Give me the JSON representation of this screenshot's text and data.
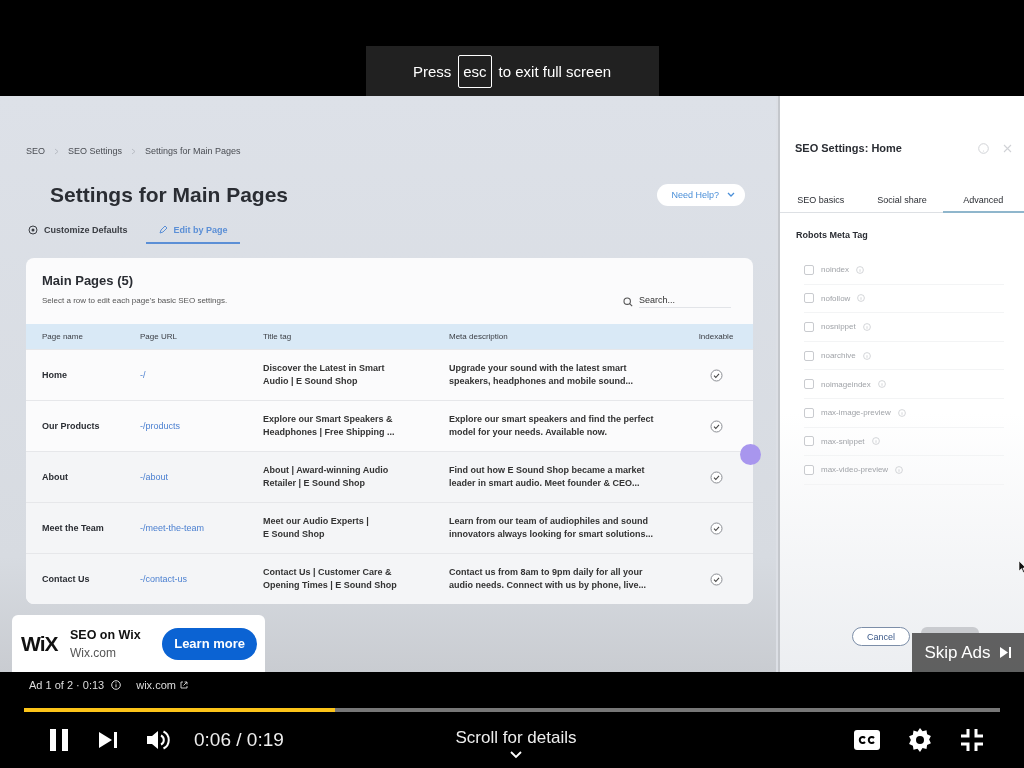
{
  "fullscreen_notice": {
    "before": "Press",
    "key": "esc",
    "after": "to exit full screen"
  },
  "video_frame": {
    "breadcrumbs": [
      "SEO",
      "SEO Settings",
      "Settings for Main Pages"
    ],
    "page_title": "Settings for Main Pages",
    "help_button": "Need Help?",
    "tabs": [
      {
        "label": "Customize Defaults",
        "selected": false
      },
      {
        "label": "Edit by Page",
        "selected": true
      }
    ],
    "table_card": {
      "title": "Main Pages (5)",
      "subtitle": "Select a row to edit each page's basic SEO settings.",
      "search": {
        "placeholder": "Search..."
      },
      "columns": [
        "Page name",
        "Page URL",
        "Title tag",
        "Meta description",
        "Indexable"
      ],
      "rows": [
        {
          "page_name": "Home",
          "page_url": "-/",
          "title_tag": "Discover the Latest in Smart\nAudio | E Sound Shop",
          "meta_description": "Upgrade your sound with the latest smart\nspeakers, headphones and mobile sound...",
          "indexable": true
        },
        {
          "page_name": "Our Products",
          "page_url": "-/products",
          "title_tag": "Explore our Smart Speakers &\nHeadphones | Free Shipping ...",
          "meta_description": "Explore our smart speakers and find the perfect\nmodel for your needs. Available now.",
          "indexable": true
        },
        {
          "page_name": "About",
          "page_url": "-/about",
          "title_tag": "About | Award-winning Audio\nRetailer | E Sound Shop",
          "meta_description": "Find out how E Sound Shop became a market\nleader in smart audio. Meet founder & CEO...",
          "indexable": true
        },
        {
          "page_name": "Meet the Team",
          "page_url": "-/meet-the-team",
          "title_tag": "Meet our Audio Experts |\nE Sound Shop",
          "meta_description": "Learn from our team of audiophiles and sound\ninnovators always looking for smart solutions...",
          "indexable": true
        },
        {
          "page_name": "Contact Us",
          "page_url": "-/contact-us",
          "title_tag": "Contact Us | Customer Care &\nOpening Times | E Sound Shop",
          "meta_description": "Contact us from 8am to 9pm daily for all your\naudio needs. Connect with us by phone, live...",
          "indexable": true
        }
      ]
    },
    "side_panel": {
      "title": "SEO Settings: Home",
      "tabs": [
        {
          "label": "SEO basics",
          "selected": false
        },
        {
          "label": "Social share",
          "selected": false
        },
        {
          "label": "Advanced",
          "selected": true
        }
      ],
      "section_title": "Robots Meta Tag",
      "options": [
        {
          "label": "noindex",
          "checked": false
        },
        {
          "label": "nofollow",
          "checked": false
        },
        {
          "label": "nosnippet",
          "checked": false
        },
        {
          "label": "noarchive",
          "checked": false
        },
        {
          "label": "noimageindex",
          "checked": false
        },
        {
          "label": "max-image-preview",
          "checked": false
        },
        {
          "label": "max-snippet",
          "checked": false
        },
        {
          "label": "max-video-preview",
          "checked": false
        }
      ],
      "buttons": [
        "Cancel"
      ]
    }
  },
  "ad": {
    "logo_text": "WiX",
    "advertiser": "SEO on Wix",
    "domain": "Wix.com",
    "cta": "Learn more"
  },
  "skip_button": "Skip Ads",
  "ad_info": {
    "position": "Ad 1 of 2 · 0:13",
    "link": "wix.com"
  },
  "player": {
    "playing": true,
    "progress": {
      "level": 0.319
    },
    "time": "0:06 / 0:19",
    "details_hint": "Scroll for details"
  }
}
